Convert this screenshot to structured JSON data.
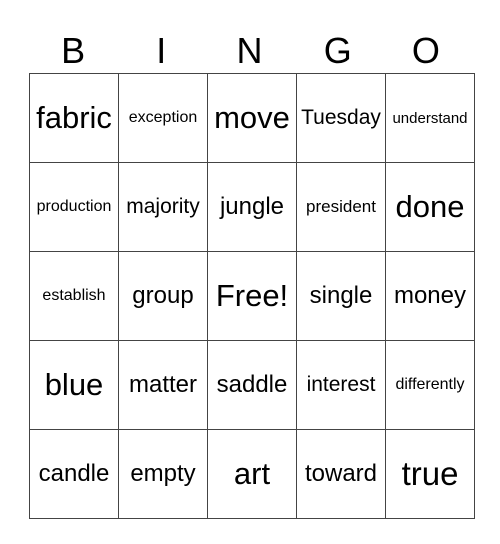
{
  "header": [
    "B",
    "I",
    "N",
    "G",
    "O"
  ],
  "rows": [
    [
      "fabric",
      "exception",
      "move",
      "Tuesday",
      "understand"
    ],
    [
      "production",
      "majority",
      "jungle",
      "president",
      "done"
    ],
    [
      "establish",
      "group",
      "Free!",
      "single",
      "money"
    ],
    [
      "blue",
      "matter",
      "saddle",
      "interest",
      "differently"
    ],
    [
      "candle",
      "empty",
      "art",
      "toward",
      "true"
    ]
  ]
}
